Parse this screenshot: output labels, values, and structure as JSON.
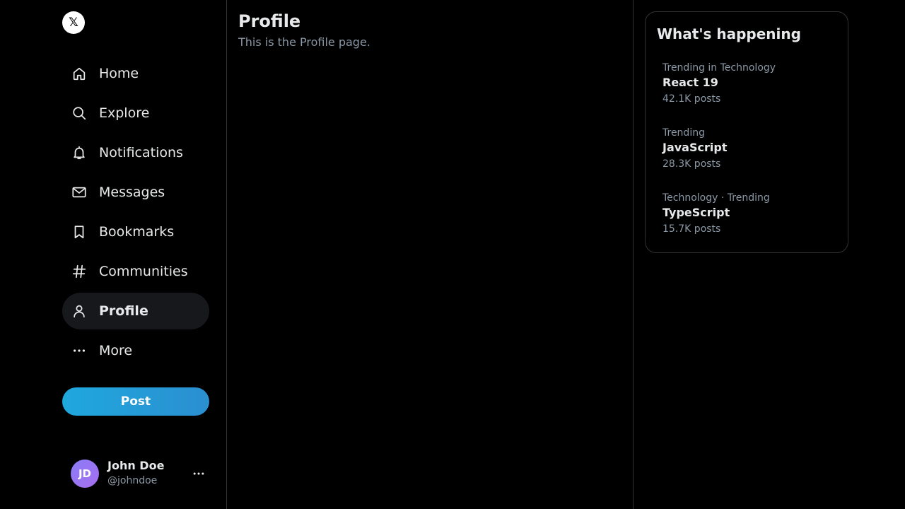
{
  "sidebar": {
    "logo": "𝕏",
    "nav": [
      {
        "label": "Home",
        "icon": "home-icon"
      },
      {
        "label": "Explore",
        "icon": "search-icon"
      },
      {
        "label": "Notifications",
        "icon": "bell-icon"
      },
      {
        "label": "Messages",
        "icon": "mail-icon"
      },
      {
        "label": "Bookmarks",
        "icon": "bookmark-icon"
      },
      {
        "label": "Communities",
        "icon": "hash-icon"
      },
      {
        "label": "Profile",
        "icon": "user-icon",
        "active": true
      },
      {
        "label": "More",
        "icon": "more-icon"
      }
    ],
    "post_label": "Post",
    "account": {
      "initials": "JD",
      "name": "John Doe",
      "handle": "@johndoe",
      "more": "···"
    }
  },
  "main": {
    "title": "Profile",
    "subtitle": "This is the Profile page."
  },
  "trends": {
    "title": "What's happening",
    "items": [
      {
        "context": "Trending in Technology",
        "name": "React 19",
        "count": "42.1K posts"
      },
      {
        "context": "Trending",
        "name": "JavaScript",
        "count": "28.3K posts"
      },
      {
        "context": "Technology · Trending",
        "name": "TypeScript",
        "count": "15.7K posts"
      }
    ]
  },
  "colors": {
    "background": "#000000",
    "accent": "#1d9bf0",
    "text": "#e7e9ea",
    "muted": "#8b98a5",
    "border": "#2f3336"
  }
}
